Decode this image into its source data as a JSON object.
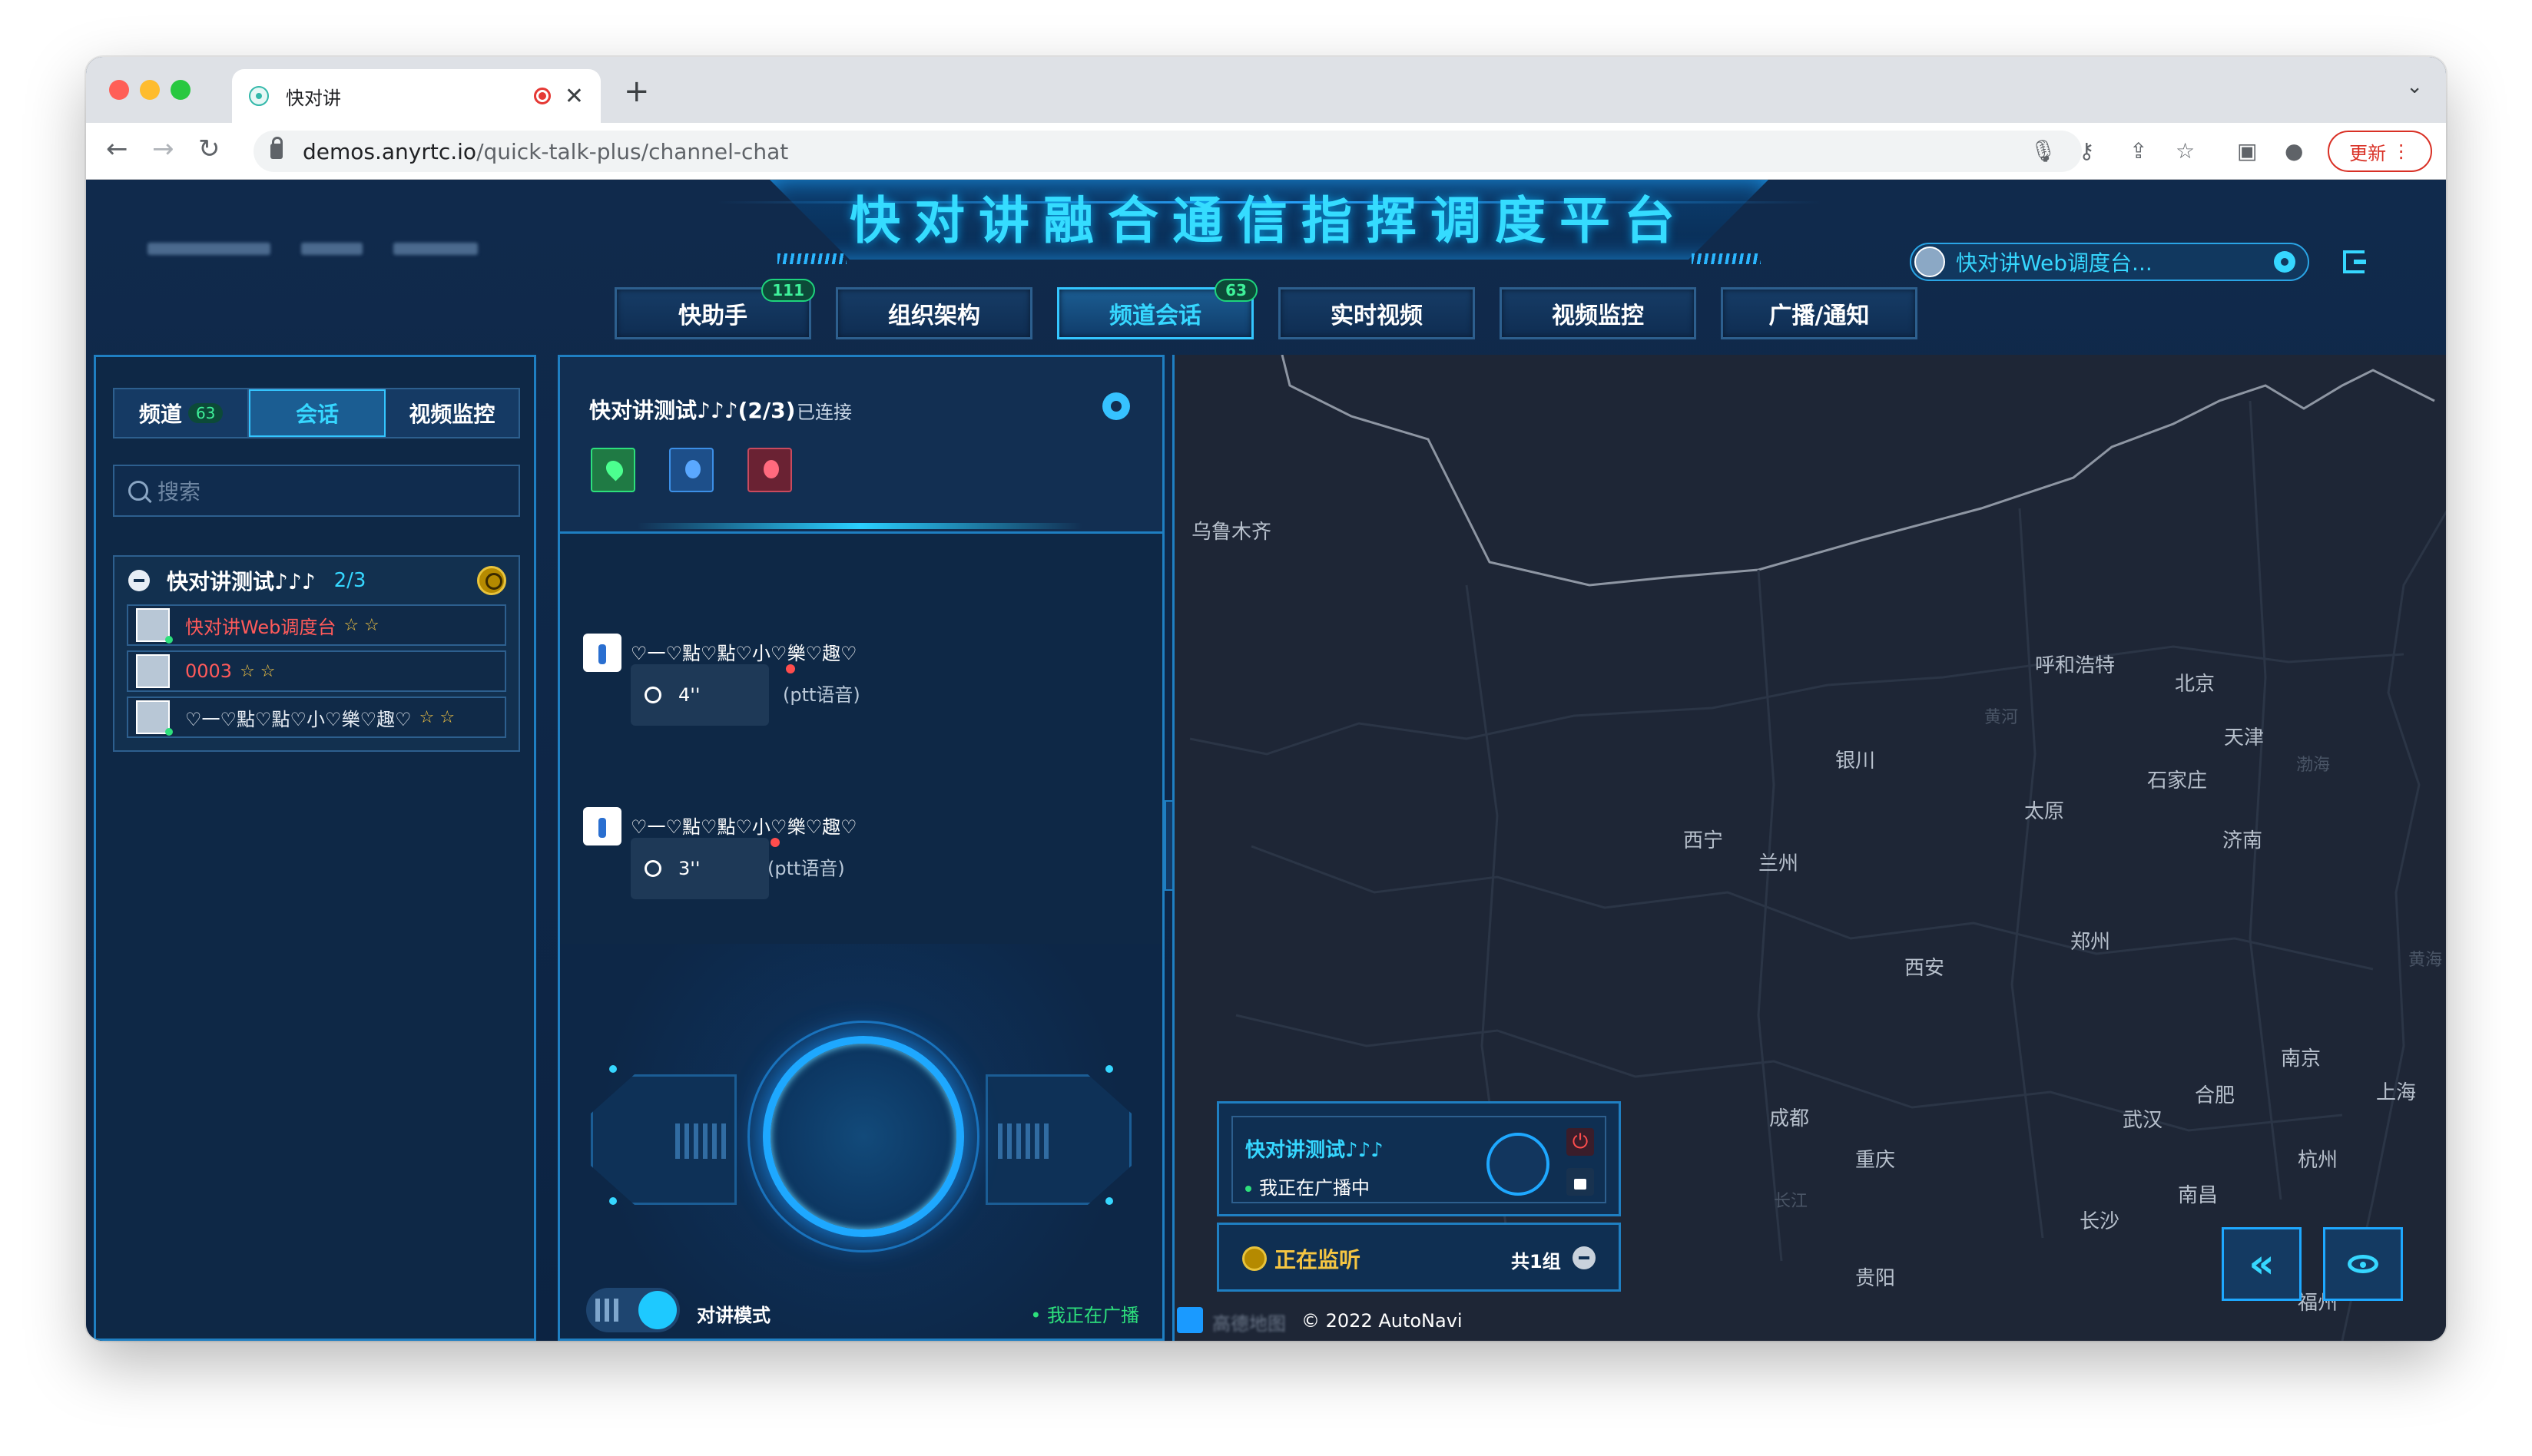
{
  "browser": {
    "tab_title": "快对讲",
    "url_host": "demos.anyrtc.io",
    "url_path": "/quick-talk-plus/channel-chat",
    "update_label": "更新",
    "new_tab": "+",
    "close": "✕",
    "tab_menu": "⌄"
  },
  "header": {
    "title": "快对讲融合通信指挥调度平台",
    "account_name": "快对讲Web调度台..."
  },
  "nav": [
    {
      "label": "快助手",
      "badge": "111"
    },
    {
      "label": "组织架构",
      "badge": ""
    },
    {
      "label": "频道会话",
      "badge": "63",
      "active": true
    },
    {
      "label": "实时视频",
      "badge": ""
    },
    {
      "label": "视频监控",
      "badge": ""
    },
    {
      "label": "广播/通知",
      "badge": ""
    }
  ],
  "left": {
    "tabs": {
      "channel": "频道",
      "channel_count": "63",
      "session": "会话",
      "video": "视频监控"
    },
    "search_placeholder": "搜索",
    "group": {
      "name": "快对讲测试♪♪♪",
      "count": "2/3"
    },
    "members": [
      {
        "name": "快对讲Web调度台",
        "stars": "☆ ☆",
        "color": "#ff5a5a"
      },
      {
        "name": "0003",
        "stars": "☆ ☆",
        "color": "#ff5a5a"
      },
      {
        "name": "♡一♡點♡點♡小♡樂♡趣♡",
        "stars": "☆ ☆",
        "color": "#e8eef5"
      }
    ]
  },
  "chat": {
    "channel_title": "快对讲测试♪♪♪(2/3)",
    "status": "已连接",
    "messages": [
      {
        "sender": "♡一♡點♡點♡小♡樂♡趣♡",
        "duration": "4''",
        "tag": "(ptt语音)"
      },
      {
        "sender": "♡一♡點♡點♡小♡樂♡趣♡",
        "duration": "3''",
        "tag": "(ptt语音)"
      }
    ],
    "mode_label": "对讲模式",
    "broadcasting": "• 我正在广播"
  },
  "map": {
    "cities": [
      "乌鲁木齐",
      "呼和浩特",
      "北京",
      "天津",
      "银川",
      "石家庄",
      "太原",
      "西宁",
      "兰州",
      "济南",
      "郑州",
      "西安",
      "南京",
      "上海",
      "合肥",
      "成都",
      "武汉",
      "杭州",
      "重庆",
      "南昌",
      "长沙",
      "贵阳",
      "福州"
    ],
    "water": [
      "黄河",
      "渤海",
      "黄海",
      "长江"
    ],
    "copyright": "© 2022 AutoNavi",
    "provider": "高德地图"
  },
  "broadcast_card": {
    "channel": "快对讲测试♪♪♪",
    "status": "我正在广播中",
    "power_icon": "⏻"
  },
  "monitor_card": {
    "label": "正在监听",
    "groups": "共1组"
  },
  "controls": {
    "collapse": "‹",
    "back": "«"
  }
}
